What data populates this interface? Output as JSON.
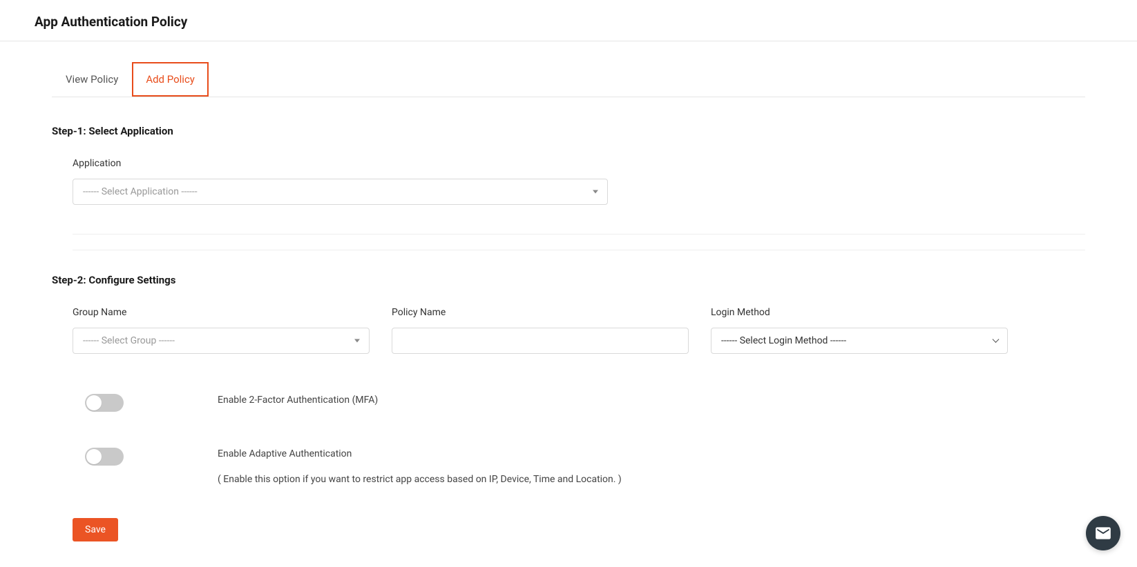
{
  "header": {
    "title": "App Authentication Policy"
  },
  "tabs": {
    "view": "View Policy",
    "add": "Add Policy"
  },
  "step1": {
    "heading": "Step-1: Select Application",
    "application_label": "Application",
    "application_placeholder": "------ Select Application ------"
  },
  "step2": {
    "heading": "Step-2: Configure Settings",
    "group_label": "Group Name",
    "group_placeholder": "------ Select Group ------",
    "policy_label": "Policy Name",
    "policy_value": "",
    "login_label": "Login Method",
    "login_placeholder": "------ Select Login Method ------"
  },
  "toggles": {
    "mfa_label": "Enable 2-Factor Authentication (MFA)",
    "adaptive_label": "Enable Adaptive Authentication",
    "adaptive_help": "( Enable this option if you want to restrict app access based on IP, Device, Time and Location. )"
  },
  "buttons": {
    "save": "Save"
  }
}
